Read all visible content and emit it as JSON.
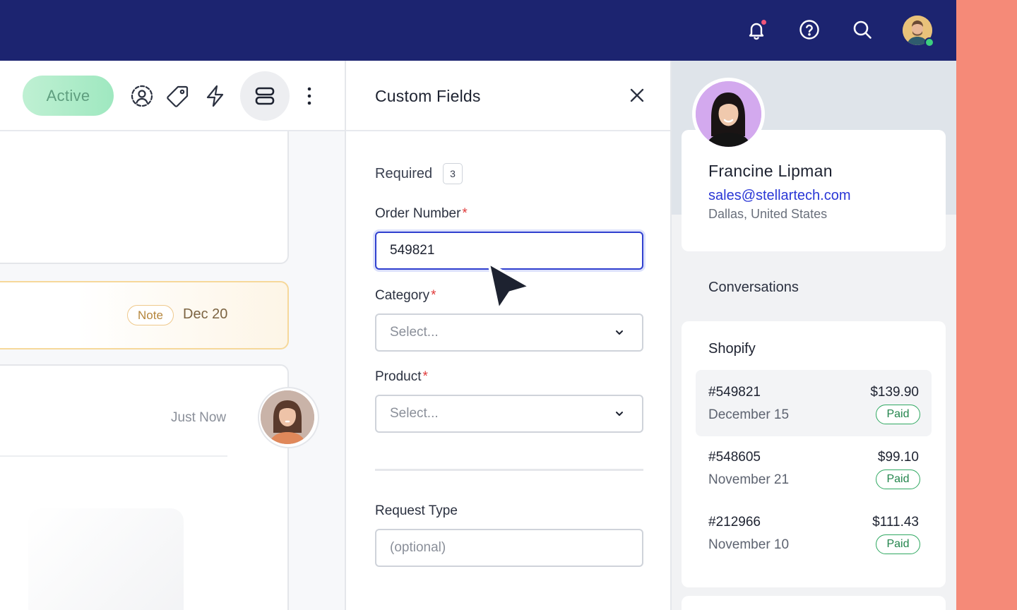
{
  "colors": {
    "topbar": "#1c2470",
    "accent": "#3040cf",
    "paid": "#2fa861",
    "required_star": "#e03a3a",
    "coral": "#f58a78"
  },
  "topbar": {
    "icons": [
      "bell-icon",
      "help-icon",
      "search-icon",
      "user-avatar"
    ]
  },
  "toolbar": {
    "status_label": "Active",
    "icons": [
      "contact-icon",
      "tag-icon",
      "lightning-icon",
      "layout-icon",
      "more-icon"
    ]
  },
  "timeline": {
    "note_badge": "Note",
    "note_date": "Dec 20",
    "message_time": "Just Now"
  },
  "custom_fields": {
    "title": "Custom Fields",
    "required_label": "Required",
    "required_count": "3",
    "order_number": {
      "label": "Order Number",
      "value": "549821"
    },
    "category": {
      "label": "Category",
      "placeholder": "Select..."
    },
    "product": {
      "label": "Product",
      "placeholder": "Select..."
    },
    "request_type": {
      "label": "Request Type",
      "placeholder": "(optional)"
    },
    "required_marker": "*"
  },
  "profile": {
    "name": "Francine Lipman",
    "email": "sales@stellartech.com",
    "location": "Dallas, United States"
  },
  "conversations_label": "Conversations",
  "shopify": {
    "title": "Shopify",
    "orders": [
      {
        "id": "#549821",
        "date": "December 15",
        "amount": "$139.90",
        "status": "Paid"
      },
      {
        "id": "#548605",
        "date": "November 21",
        "amount": "$99.10",
        "status": "Paid"
      },
      {
        "id": "#212966",
        "date": "November 10",
        "amount": "$111.43",
        "status": "Paid"
      }
    ]
  }
}
